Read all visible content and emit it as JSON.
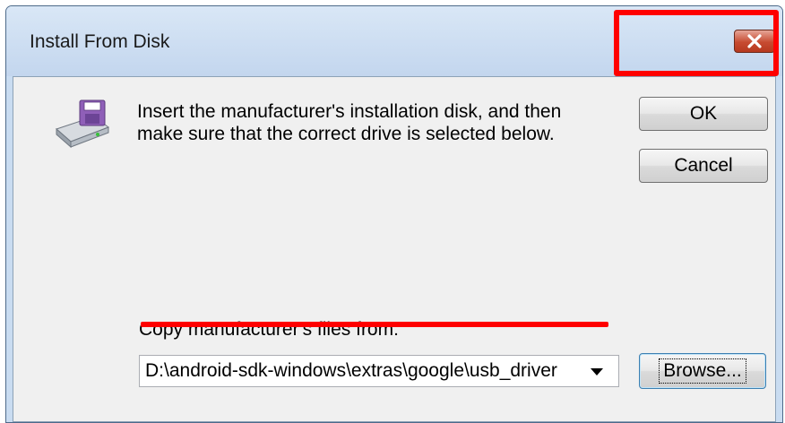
{
  "window": {
    "title": "Install From Disk"
  },
  "icons": {
    "close": "close-icon",
    "disk": "floppy-disk-drive-icon",
    "dropdown": "chevron-down-icon"
  },
  "message": "Insert the manufacturer's installation disk, and then make sure that the correct drive is selected below.",
  "buttons": {
    "ok_label": "OK",
    "cancel_label": "Cancel",
    "browse_label": "Browse..."
  },
  "copy_from": {
    "label": "Copy manufacturer's files from:",
    "value": "D:\\android-sdk-windows\\extras\\google\\usb_driver"
  },
  "colors": {
    "highlight": "#ff0000",
    "close_button": "#c74b31"
  }
}
